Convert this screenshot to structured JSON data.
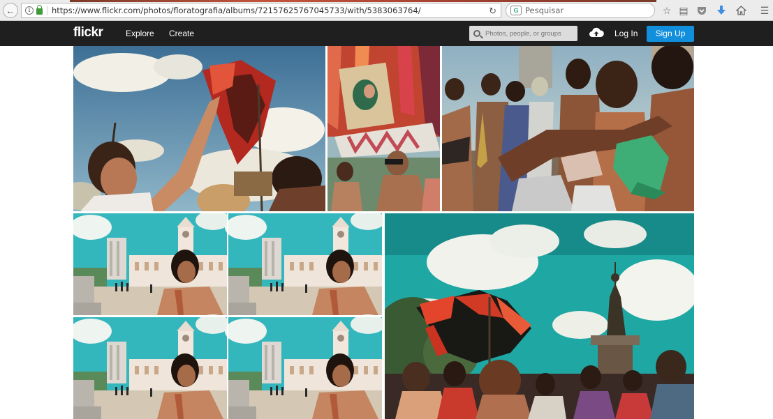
{
  "browser": {
    "url": "https://www.flickr.com/photos/floratografia/albums/72157625767045733/with/5383063764/",
    "search_placeholder": "Pesquisar"
  },
  "header": {
    "logo": "flickr",
    "nav": [
      "Explore",
      "Create"
    ],
    "search_placeholder": "Photos, people, or groups",
    "login_label": "Log In",
    "signup_label": "Sign Up"
  },
  "icons": {
    "back": "back-arrow-icon",
    "info": "info-icon",
    "lock": "lock-icon",
    "reload": "reload-icon",
    "star": "star-icon",
    "reading_list": "clipboard-icon",
    "pocket": "pocket-icon",
    "download": "download-icon",
    "home": "home-icon",
    "menu": "hamburger-menu-icon",
    "search": "search-icon",
    "upload": "cloud-upload-icon"
  },
  "colors": {
    "header_bg": "#1f1f1f",
    "signup_bg": "#128fdc"
  },
  "album": {
    "photos": [
      {
        "subject": "raised hand with red flag against blue sky"
      },
      {
        "subject": "colorful ribbon banner and shirtless man"
      },
      {
        "subject": "street parade with musicians and green cap"
      },
      {
        "subject": "four-panel collage of man before white palace"
      },
      {
        "subject": "red and black flag before statue under teal sky"
      }
    ]
  }
}
